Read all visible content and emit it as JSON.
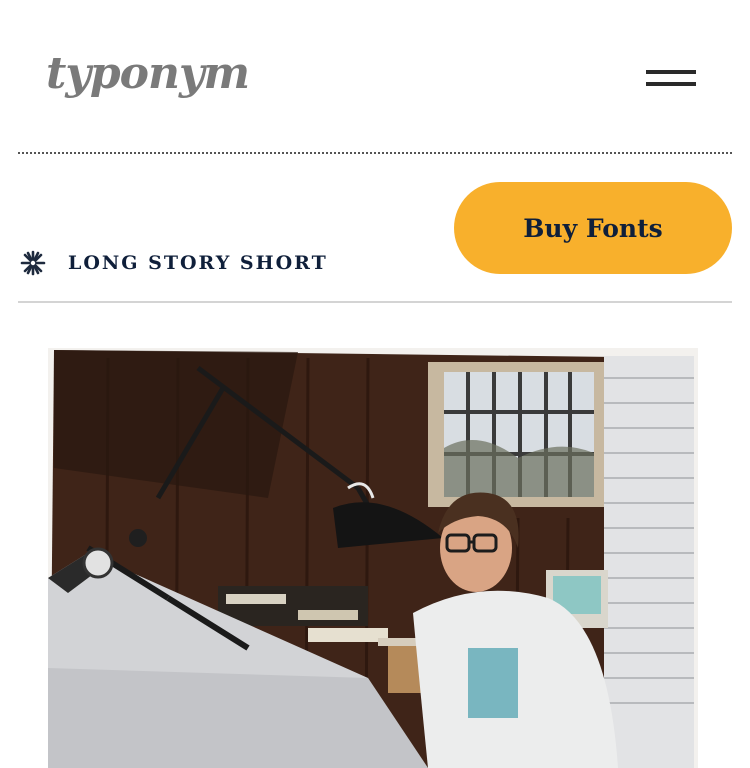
{
  "header": {
    "logo_text": "typonym",
    "menu_icon": "hamburger-menu-icon"
  },
  "section": {
    "icon": "asterisk-star-icon",
    "label": "LONG STORY SHORT"
  },
  "buy_button": {
    "label": "Buy Fonts",
    "color": "#f8b02c",
    "text_color": "#0f1f3a"
  },
  "photo": {
    "subject": "vintage-studio-photograph"
  }
}
